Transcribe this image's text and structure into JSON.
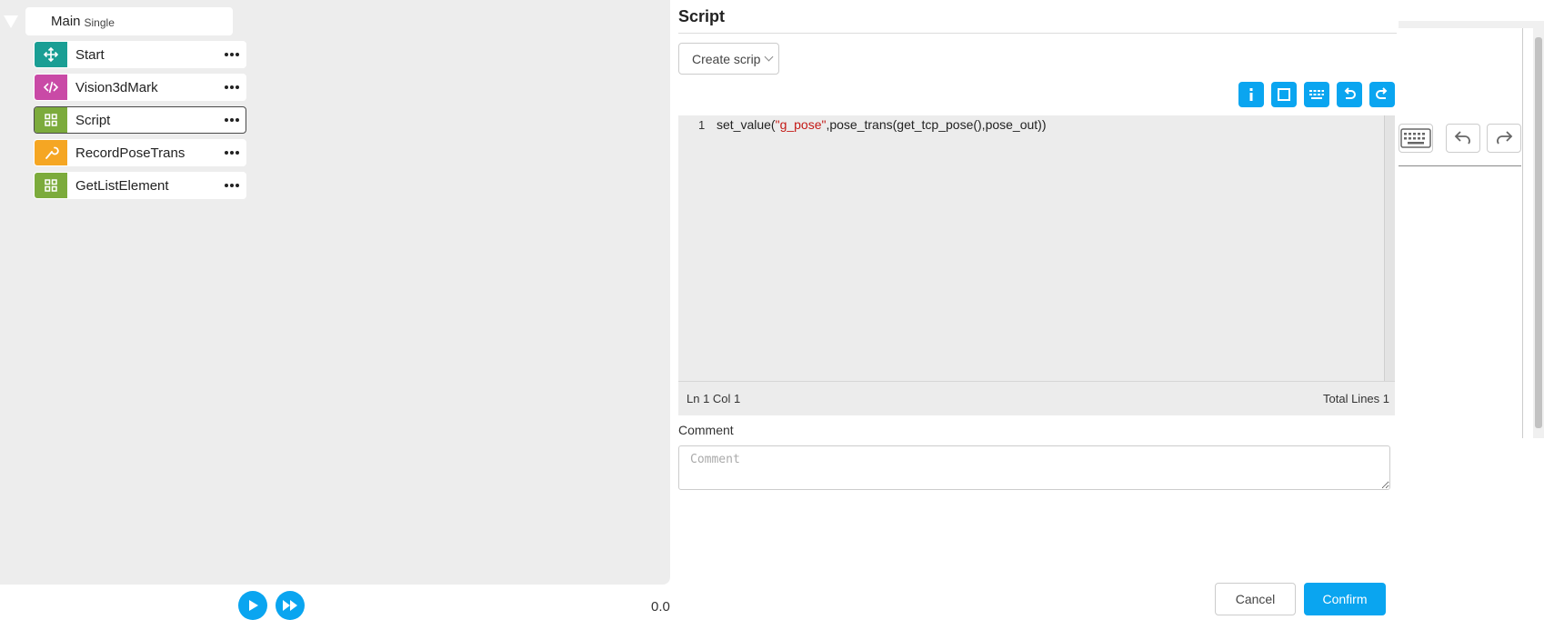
{
  "tree": {
    "root": {
      "name": "Main",
      "tag": "Single"
    },
    "nodes": [
      {
        "label": "Start",
        "color": "#1a9e94",
        "icon": "move-icon",
        "selected": false
      },
      {
        "label": "Vision3dMark",
        "color": "#c94aa6",
        "icon": "code-icon",
        "selected": false
      },
      {
        "label": "Script",
        "color": "#7cab3c",
        "icon": "grid-icon",
        "selected": true
      },
      {
        "label": "RecordPoseTrans",
        "color": "#f5a623",
        "icon": "wrench-icon",
        "selected": false
      },
      {
        "label": "GetListElement",
        "color": "#7cab3c",
        "icon": "grid-icon",
        "selected": false
      }
    ]
  },
  "playback": {
    "speed_value": "0.0"
  },
  "dialog": {
    "title": "Script",
    "create_script_label": "Create scrip",
    "toolbar": [
      "info-icon",
      "fullscreen-icon",
      "keyboard-icon",
      "undo-icon",
      "redo-icon"
    ],
    "editor": {
      "line_number": "1",
      "code_before": "set_value(",
      "code_string": "\"g_pose\"",
      "code_after": ",pose_trans(get_tcp_pose(),pose_out))"
    },
    "status": {
      "position": "Ln 1 Col 1",
      "total": "Total Lines 1"
    },
    "comment": {
      "label": "Comment",
      "placeholder": "Comment",
      "value": ""
    },
    "cancel_label": "Cancel",
    "confirm_label": "Confirm"
  },
  "colors": {
    "accent": "#0aa5f0"
  }
}
